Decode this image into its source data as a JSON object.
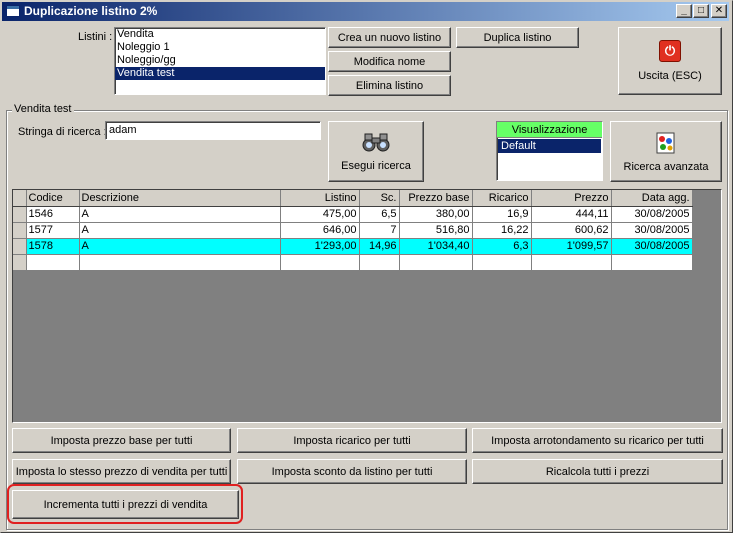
{
  "window": {
    "title": "Duplicazione listino 2%"
  },
  "listini": {
    "label": "Listini :",
    "items": [
      "Vendita",
      "Noleggio 1",
      "Noleggio/gg",
      "Vendita test"
    ],
    "selected_index": 3
  },
  "actions": {
    "crea": "Crea un nuovo listino",
    "duplica": "Duplica listino",
    "modifica": "Modifica nome",
    "elimina": "Elimina listino",
    "uscita": "Uscita (ESC)"
  },
  "group": {
    "title": "Vendita test",
    "search_label": "Stringa di ricerca :",
    "search_value": "adam",
    "esegui": "Esegui ricerca",
    "visual_header": "Visualizzazione",
    "visual_items": [
      "Default"
    ],
    "ricerca_avanzata": "Ricerca avanzata"
  },
  "grid": {
    "columns": [
      "Codice",
      "Descrizione",
      "Listino",
      "Sc.",
      "Prezzo base",
      "Ricarico",
      "Prezzo",
      "Data agg."
    ],
    "rows": [
      {
        "codice": "1546",
        "descrizione": "A",
        "listino": "475,00",
        "sc": "6,5",
        "prezzo_base": "380,00",
        "ricarico": "16,9",
        "prezzo": "444,11",
        "data": "30/08/2005"
      },
      {
        "codice": "1577",
        "descrizione": "A",
        "listino": "646,00",
        "sc": "7",
        "prezzo_base": "516,80",
        "ricarico": "16,22",
        "prezzo": "600,62",
        "data": "30/08/2005"
      },
      {
        "codice": "1578",
        "descrizione": "A",
        "listino": "1'293,00",
        "sc": "14,96",
        "prezzo_base": "1'034,40",
        "ricarico": "6,3",
        "prezzo": "1'099,57",
        "data": "30/08/2005"
      }
    ],
    "highlighted_row": 2
  },
  "bulk": {
    "imposta_prezzo_base": "Imposta prezzo base per tutti",
    "imposta_ricarico": "Imposta ricarico per tutti",
    "imposta_arrotondamento": "Imposta arrotondamento su ricarico per tutti",
    "imposta_stesso_prezzo": "Imposta lo stesso prezzo di vendita per tutti",
    "imposta_sconto": "Imposta sconto da listino per tutti",
    "ricalcola": "Ricalcola tutti i prezzi",
    "incrementa": "Incrementa tutti i prezzi di vendita"
  },
  "colors": {
    "title_start": "#0a246a",
    "selection": "#0a246a",
    "row_highlight": "#00ffff",
    "visual_header": "#66ff66",
    "annotation_ring": "#e02020"
  }
}
